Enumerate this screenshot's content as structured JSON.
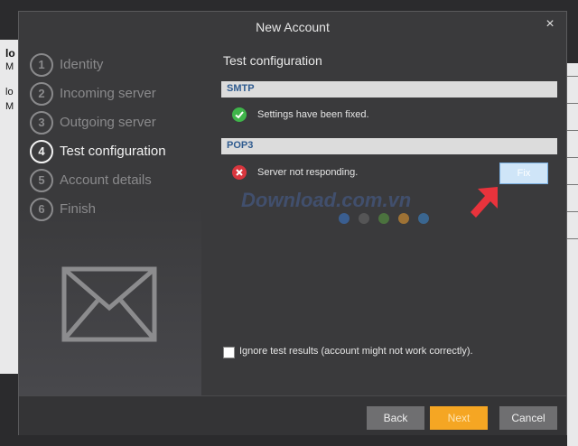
{
  "background_app": {
    "left_rows": [
      "lo",
      "M",
      "lo",
      "M"
    ]
  },
  "dialog": {
    "title": "New Account",
    "close_glyph": "×"
  },
  "steps": [
    {
      "num": "1",
      "label": "Identity",
      "active": false
    },
    {
      "num": "2",
      "label": "Incoming server",
      "active": false
    },
    {
      "num": "3",
      "label": "Outgoing server",
      "active": false
    },
    {
      "num": "4",
      "label": "Test configuration",
      "active": true
    },
    {
      "num": "5",
      "label": "Account details",
      "active": false
    },
    {
      "num": "6",
      "label": "Finish",
      "active": false
    }
  ],
  "main": {
    "heading": "Test configuration",
    "smtp": {
      "label": "SMTP",
      "status_text": "Settings have been fixed.",
      "status_icon": "check-circle-icon",
      "status_color": "#3fb54a"
    },
    "pop3": {
      "label": "POP3",
      "status_text": "Server not responding.",
      "status_icon": "error-circle-icon",
      "status_color": "#d9363e",
      "fix_label": "Fix"
    },
    "ignore_label": "Ignore test results (account might not work correctly)."
  },
  "watermark": {
    "text": "Download.com.vn",
    "dot_colors": [
      "#3a7bd5",
      "#6c6c6c",
      "#5aa040",
      "#f0a030",
      "#3a8ad5",
      "#d03a3a"
    ]
  },
  "footer": {
    "back_label": "Back",
    "next_label": "Next",
    "cancel_label": "Cancel"
  },
  "colors": {
    "accent": "#f5a623",
    "section_label": "#2f5b8f",
    "annotation_arrow": "#e8333c"
  }
}
